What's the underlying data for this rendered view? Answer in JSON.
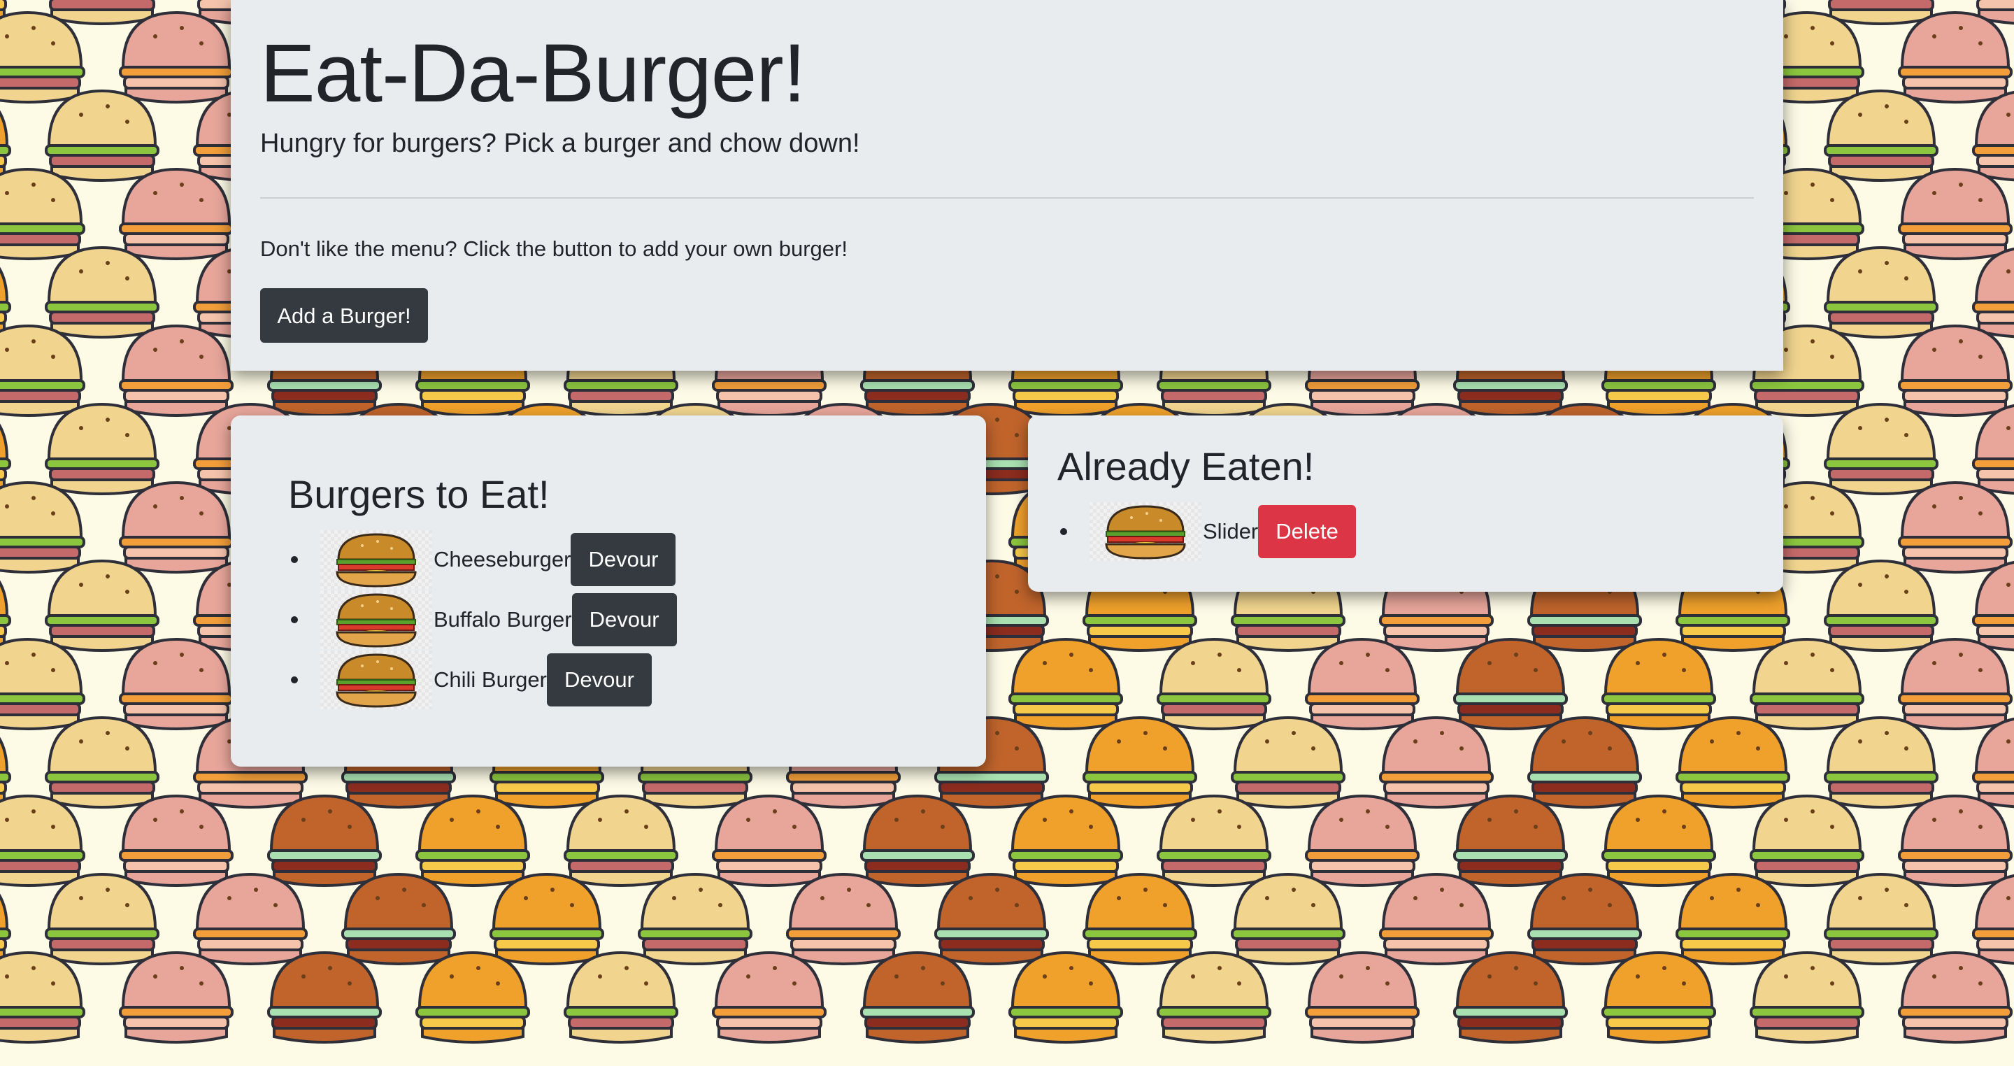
{
  "header": {
    "title": "Eat-Da-Burger!",
    "lead": "Hungry for burgers? Pick a burger and chow down!",
    "prompt": "Don't like the menu? Click the button to add your own burger!",
    "add_button": "Add a Burger!"
  },
  "to_eat": {
    "title": "Burgers to Eat!",
    "button_label": "Devour",
    "items": [
      {
        "name": "Cheeseburger"
      },
      {
        "name": "Buffalo Burger"
      },
      {
        "name": "Chili Burger"
      }
    ]
  },
  "eaten": {
    "title": "Already Eaten!",
    "button_label": "Delete",
    "items": [
      {
        "name": "Slider"
      }
    ]
  },
  "icons": {
    "burger": "burger-icon"
  },
  "colors": {
    "page_background": "#fdfbe6",
    "panel": "#e9ecef",
    "dark_button": "#343a40",
    "danger_button": "#dc3545"
  }
}
